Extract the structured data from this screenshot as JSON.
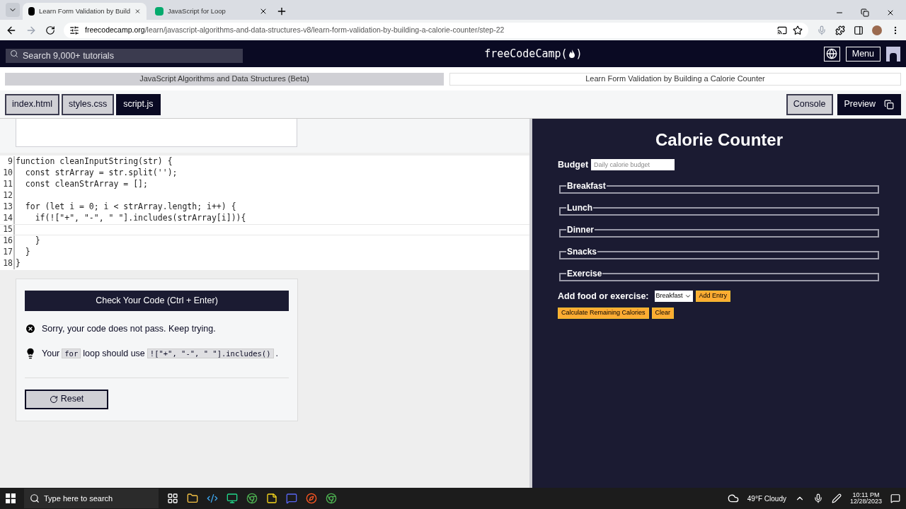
{
  "browser": {
    "tabs": [
      {
        "title": "Learn Form Validation by Build",
        "selected": true
      },
      {
        "title": "JavaScript for Loop",
        "selected": false
      }
    ],
    "url_host": "freecodecamp.org",
    "url_path": "/learn/javascript-algorithms-and-data-structures-v8/learn-form-validation-by-building-a-calorie-counter/step-22"
  },
  "navbar": {
    "search_placeholder": "Search 9,000+ tutorials",
    "logo": "freeCodeCamp(",
    "logo_end": ")",
    "menu": "Menu"
  },
  "breadcrumb": [
    "JavaScript Algorithms and Data Structures (Beta)",
    "Learn Form Validation by Building a Calorie Counter"
  ],
  "file_tabs": [
    {
      "label": "index.html",
      "selected": false
    },
    {
      "label": "styles.css",
      "selected": false
    },
    {
      "label": "script.js",
      "selected": true
    }
  ],
  "view_buttons": [
    {
      "label": "Console",
      "selected": false
    },
    {
      "label": "Preview",
      "selected": true
    }
  ],
  "code": [
    {
      "number": "9",
      "text": "function cleanInputString(str) {"
    },
    {
      "number": "10",
      "text": "  const strArray = str.split('');"
    },
    {
      "number": "11",
      "text": "  const cleanStrArray = [];"
    },
    {
      "number": "12"
    },
    {
      "number": "13",
      "text": "  for (let i = 0; i < strArray.length; i++) {"
    },
    {
      "number": "14",
      "text": "    if(![\"+\", \"-\", \" \"].includes(strArray[i])){"
    },
    {
      "number": "15"
    },
    {
      "number": "16",
      "text": "    }"
    },
    {
      "number": "17",
      "text": "  }"
    },
    {
      "number": "18",
      "text": "}"
    }
  ],
  "check_button": "Check Your Code (Ctrl + Enter)",
  "messages": [
    {
      "kind": "error",
      "parts": [
        {
          "kind": "text",
          "text": "Sorry, your code does not pass. Keep trying."
        }
      ]
    },
    {
      "kind": "hint",
      "parts": [
        {
          "kind": "text",
          "text": "Your"
        },
        {
          "kind": "code",
          "text": "for"
        },
        {
          "kind": "text",
          "text": "loop should use"
        },
        {
          "kind": "code",
          "text": "![\"+\", \"-\", \" \"].includes()"
        },
        {
          "kind": "text",
          "text": "."
        }
      ]
    }
  ],
  "reset_button": "Reset",
  "preview": {
    "title": "Calorie Counter",
    "budget_label": "Budget",
    "budget_placeholder": "Daily calorie budget",
    "sections": [
      "Breakfast",
      "Lunch",
      "Dinner",
      "Snacks",
      "Exercise"
    ],
    "add_label": "Add food or exercise:",
    "select_value": "Breakfast",
    "buttons": [
      "Add Entry"
    ],
    "bottom_buttons": [
      "Calculate Remaining Calories",
      "Clear"
    ]
  },
  "taskbar": {
    "search_placeholder": "Type here to search",
    "weather": "49°F Cloudy",
    "time": "10:11 PM",
    "date": "12/28/2023"
  }
}
